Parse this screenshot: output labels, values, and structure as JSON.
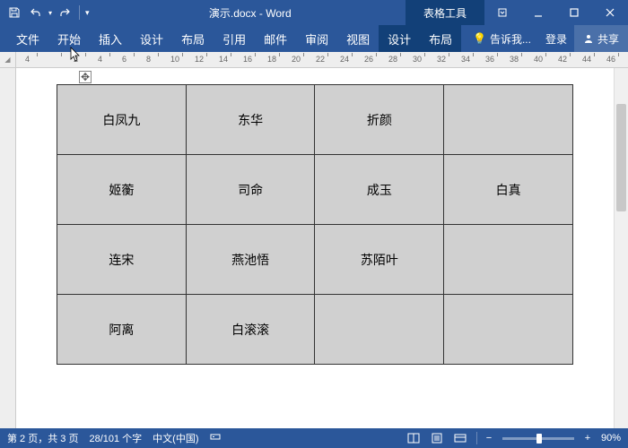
{
  "title": "演示.docx - Word",
  "contextual_tools": "表格工具",
  "qat": {
    "save": "保存",
    "undo": "撤销",
    "redo": "重做"
  },
  "tabs": {
    "file": "文件",
    "home": "开始",
    "insert": "插入",
    "design": "设计",
    "layout": "布局",
    "references": "引用",
    "mailings": "邮件",
    "review": "审阅",
    "view": "视图",
    "table_design": "设计",
    "table_layout": "布局"
  },
  "tell_me": "告诉我...",
  "login": "登录",
  "share": "共享",
  "ruler_ticks": [
    "4",
    "",
    "2",
    "4",
    "6",
    "8",
    "10",
    "12",
    "14",
    "16",
    "18",
    "20",
    "22",
    "24",
    "26",
    "28",
    "30",
    "32",
    "34",
    "36",
    "38",
    "40",
    "42",
    "44",
    "46"
  ],
  "table": {
    "rows": [
      [
        "白凤九",
        "东华",
        "折颜",
        ""
      ],
      [
        "姬蘅",
        "司命",
        "成玉",
        "白真"
      ],
      [
        "连宋",
        "燕池悟",
        "苏陌叶",
        ""
      ],
      [
        "阿离",
        "白滚滚",
        "",
        ""
      ]
    ]
  },
  "status": {
    "page": "第 2 页，共 3 页",
    "words": "28/101 个字",
    "lang": "中文(中国)",
    "zoom": "90%"
  }
}
